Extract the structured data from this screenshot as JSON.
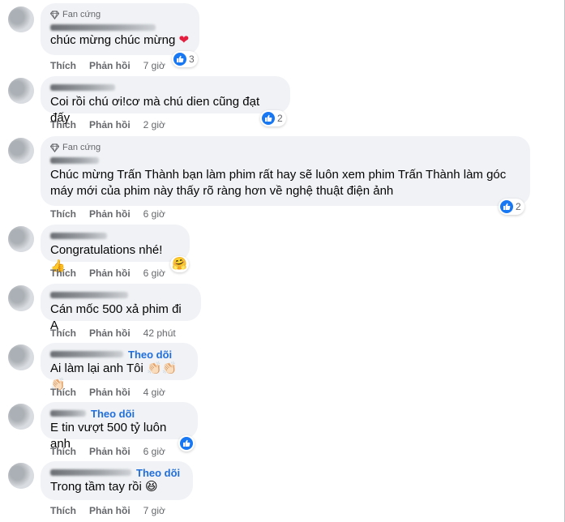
{
  "comments": [
    {
      "badge": "Fan cứng",
      "text": "chúc mừng chúc mừng",
      "time": "7 giờ",
      "reaction_count": "3"
    },
    {
      "text": "Coi rồi chú ơi!cơ mà chú dien cũng đạt đấy",
      "time": "2 giờ",
      "reaction_count": "2"
    },
    {
      "badge": "Fan cứng",
      "text_line1": "Chúc mừng Trấn Thành bạn làm phim rất hay sẽ luôn xem phim Trấn Thành làm góc",
      "text_line2": "máy mới của phim này thấy rõ ràng hơn về nghệ thuật điện ảnh",
      "time": "6 giờ",
      "reaction_count": "2"
    },
    {
      "text": "Congratulations nhé!",
      "time": "6 giờ"
    },
    {
      "text": "Cán mốc 500 xả phim đi A",
      "time": "42 phút"
    },
    {
      "follow": "Theo dõi",
      "text": "Ai làm lại anh Tôi",
      "time": "4 giờ"
    },
    {
      "follow": "Theo dõi",
      "text": "E tin vượt 500 tỷ luôn anh",
      "time": "6 giờ"
    },
    {
      "follow": "Theo dõi",
      "text": "Trong tầm tay rồi",
      "time": "7 giờ"
    }
  ],
  "actions": {
    "like": "Thích",
    "reply": "Phản hồi"
  },
  "colors": {
    "like_blue": "#1877f2",
    "follow_blue": "#216fdb",
    "bubble": "#f0f2f5",
    "heart": "#e41e3f"
  },
  "icons": {
    "fan_badge": "diamond-icon",
    "reaction": "like-icon",
    "love": "heart-icon",
    "clap": "clapping-hands-emoji",
    "laugh": "grinning-squinting-emoji",
    "care": "thumbs-up-care-emoji"
  }
}
